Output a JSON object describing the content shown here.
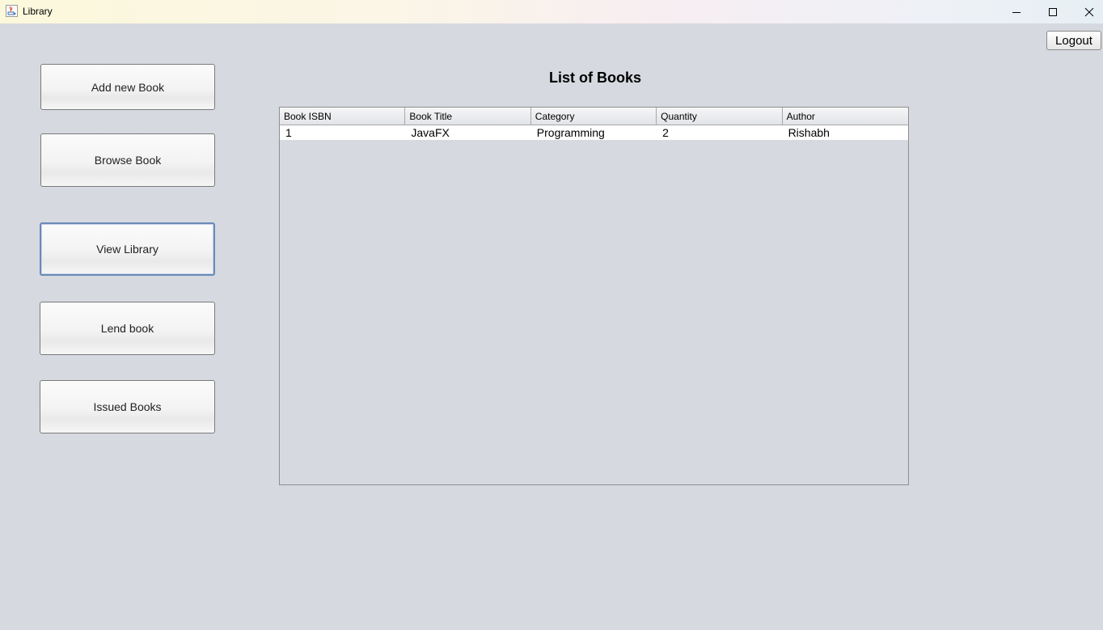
{
  "window": {
    "title": "Library",
    "app_icon": "java-cup-icon"
  },
  "header": {
    "logout_label": "Logout"
  },
  "nav": {
    "add_label": "Add new Book",
    "browse_label": "Browse Book",
    "view_label": "View Library",
    "lend_label": "Lend book",
    "issued_label": "Issued Books"
  },
  "main": {
    "heading": "List of Books",
    "table": {
      "columns": [
        "Book ISBN",
        "Book Title",
        "Category",
        "Quantity",
        "Author"
      ],
      "rows": [
        [
          "1",
          "JavaFX",
          "Programming",
          "2",
          "Rishabh"
        ]
      ]
    }
  }
}
